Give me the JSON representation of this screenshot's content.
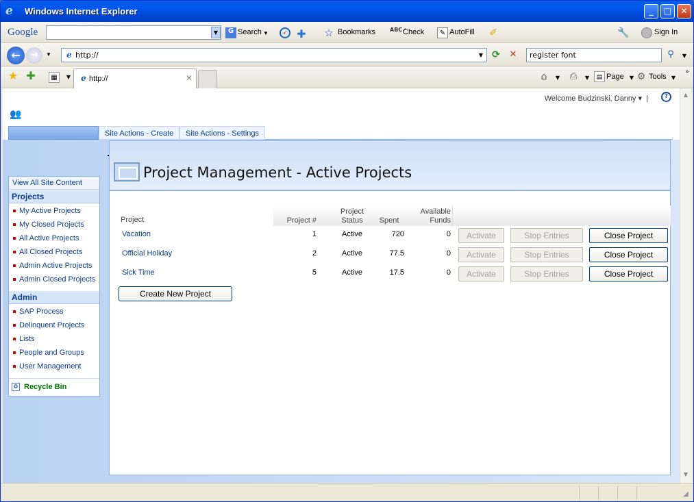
{
  "window": {
    "title": "Windows Internet Explorer"
  },
  "google_toolbar": {
    "logo": "Google",
    "search_value": "",
    "search_label": "Search",
    "bookmarks_label": "Bookmarks",
    "check_label": "Check",
    "autofill_label": "AutoFill",
    "sign_in_label": "Sign In"
  },
  "nav": {
    "address": "http://",
    "search_value": "register font"
  },
  "tabs": {
    "active_tab": "http://",
    "page_label": "Page",
    "tools_label": "Tools"
  },
  "site": {
    "welcome": "Welcome Budzinski, Danny",
    "menu": [
      "Site Actions - Create",
      "Site Actions - Settings"
    ]
  },
  "leftnav": {
    "view_all": "View All Site Content",
    "projects_heading": "Projects",
    "projects_items": [
      "My Active Projects",
      "My Closed Projects",
      "All Active Projects",
      "All Closed Projects",
      "Admin Active Projects",
      "Admin Closed Projects"
    ],
    "admin_heading": "Admin",
    "admin_items": [
      "SAP Process",
      "Delinquent Projects",
      "Lists",
      "People and Groups",
      "User Management"
    ],
    "recycle_bin": "Recycle Bin"
  },
  "main": {
    "page_title": "Project Management - Active Projects",
    "columns": {
      "project": "Project",
      "number": "Project #",
      "status": "Project\nStatus",
      "spent": "Spent",
      "funds": "Available\nFunds"
    },
    "rows": [
      {
        "project": "Vacation",
        "number": "1",
        "status": "Active",
        "spent": "720",
        "funds": "0"
      },
      {
        "project": "Official Holiday",
        "number": "2",
        "status": "Active",
        "spent": "77.5",
        "funds": "0"
      },
      {
        "project": "Sick Time",
        "number": "5",
        "status": "Active",
        "spent": "17.5",
        "funds": "0"
      }
    ],
    "activate_label": "Activate",
    "stop_entries_label": "Stop Entries",
    "close_project_label": "Close Project",
    "create_new_project_label": "Create New Project"
  }
}
